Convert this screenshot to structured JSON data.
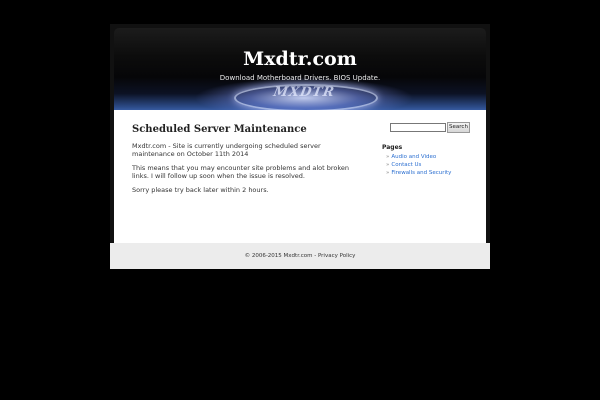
{
  "header": {
    "title": "Mxdtr.com",
    "description": "Download Motherboard Drivers. BIOS Update.",
    "logo_text": "MXDTR"
  },
  "post": {
    "title": "Scheduled Server Maintenance",
    "paragraphs": [
      "Mxdtr.com  - Site is currently undergoing scheduled server maintenance on October 11th 2014",
      "This means that you may encounter site problems and alot broken links. I will follow up soon when the issue is resolved.",
      "Sorry please try back later within 2 hours."
    ]
  },
  "sidebar": {
    "search_value": "",
    "search_button": "Search",
    "pages_heading": "Pages",
    "pages": [
      {
        "label": "Audio and Video"
      },
      {
        "label": "Contact Us"
      },
      {
        "label": "Firewalls and Security"
      }
    ],
    "bullet": "»"
  },
  "footer": {
    "copyright": "© 2006-2015 Mxdtr.com - ",
    "privacy_link": "Privacy Policy"
  },
  "colors": {
    "background": "#000000",
    "link": "#2a6ed0",
    "footer_bg": "#ececec"
  }
}
